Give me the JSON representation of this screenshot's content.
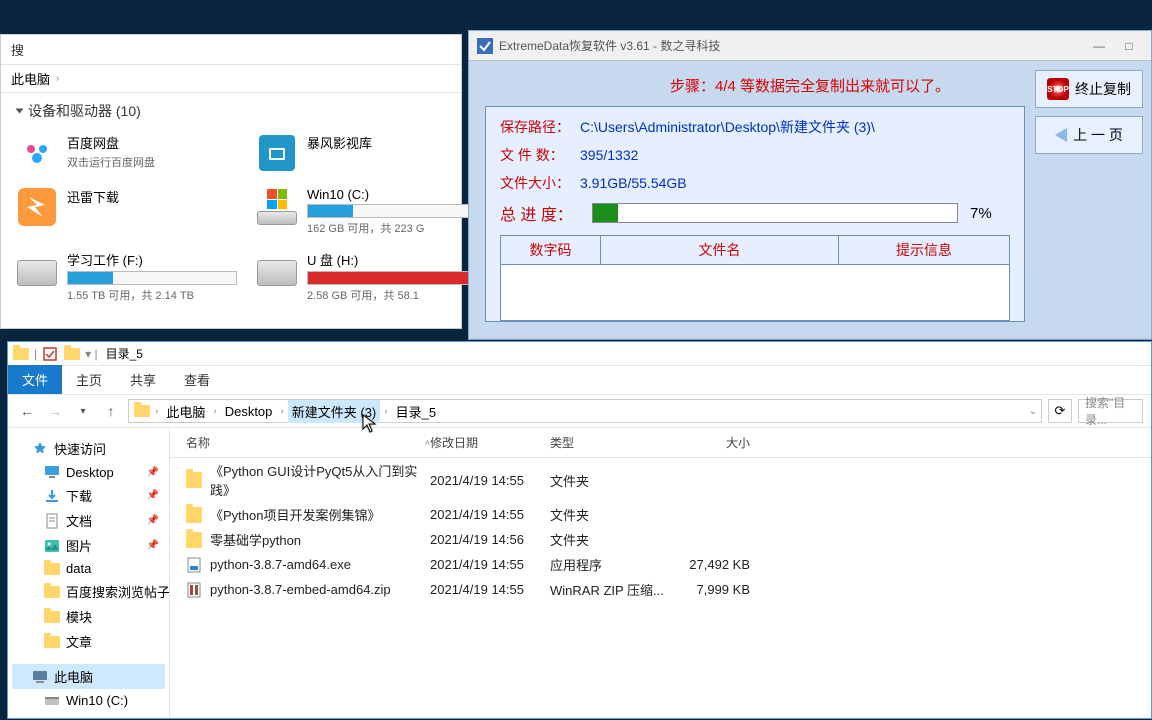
{
  "win1": {
    "ribbon_search": "搜",
    "breadcrumb": "此电脑",
    "section": "设备和驱动器 (10)",
    "drives": [
      {
        "title": "百度网盘",
        "sub": "双击运行百度网盘"
      },
      {
        "title": "暴风影视库",
        "sub": ""
      },
      {
        "title": "迅雷下载",
        "sub": ""
      },
      {
        "title": "Win10 (C:)",
        "sub": "162 GB 可用，共 223 G",
        "bar": 27,
        "color": "blue"
      },
      {
        "title": "学习工作 (F:)",
        "sub": "1.55 TB 可用，共 2.14 TB",
        "bar": 27,
        "color": "blue"
      },
      {
        "title": "U 盘 (H:)",
        "sub": "2.58 GB 可用，共 58.1",
        "bar": 96,
        "color": "red"
      }
    ]
  },
  "win2": {
    "title": "ExtremeData恢复软件 v3.61   - 数之寻科技",
    "msg": "步骤：4/4 等数据完全复制出来就可以了。",
    "rows": {
      "path_label": "保存路径：",
      "path_value": "C:\\Users\\Administrator\\Desktop\\新建文件夹 (3)\\",
      "count_label": "文 件 数：",
      "count_value": "395/1332",
      "size_label": "文件大小：",
      "size_value": "3.91GB/55.54GB",
      "prog_label": "总 进 度："
    },
    "progress_pct": "7%",
    "progress_fill": 7,
    "table": {
      "col1": "数字码",
      "col2": "文件名",
      "col3": "提示信息"
    },
    "btn_stop": "终止复制",
    "btn_prev": "上 一 页",
    "stop_icon_text": "STOP"
  },
  "win3": {
    "title": "目录_5",
    "tabs": [
      "文件",
      "主页",
      "共享",
      "查看"
    ],
    "breadcrumb": [
      "此电脑",
      "Desktop",
      "新建文件夹 (3)",
      "目录_5"
    ],
    "search_placeholder": "搜索\"目录...",
    "columns": {
      "name": "名称",
      "date": "修改日期",
      "type": "类型",
      "size": "大小"
    },
    "tree": {
      "quick": "快速访问",
      "items": [
        {
          "label": "Desktop",
          "pin": true,
          "icon": "desktop"
        },
        {
          "label": "下载",
          "pin": true,
          "icon": "download"
        },
        {
          "label": "文档",
          "pin": true,
          "icon": "doc"
        },
        {
          "label": "图片",
          "pin": true,
          "icon": "pic"
        },
        {
          "label": "data",
          "icon": "folder"
        },
        {
          "label": "百度搜索浏览帖子",
          "icon": "folder"
        },
        {
          "label": "模块",
          "icon": "folder"
        },
        {
          "label": "文章",
          "icon": "folder"
        }
      ],
      "thispc": "此电脑",
      "win10": "Win10 (C:)"
    },
    "files": [
      {
        "name": "《Python GUI设计PyQt5从入门到实践》",
        "date": "2021/4/19 14:55",
        "type": "文件夹",
        "size": "",
        "icon": "folder"
      },
      {
        "name": "《Python项目开发案例集锦》",
        "date": "2021/4/19 14:55",
        "type": "文件夹",
        "size": "",
        "icon": "folder"
      },
      {
        "name": "零基础学python",
        "date": "2021/4/19 14:56",
        "type": "文件夹",
        "size": "",
        "icon": "folder"
      },
      {
        "name": "python-3.8.7-amd64.exe",
        "date": "2021/4/19 14:55",
        "type": "应用程序",
        "size": "27,492 KB",
        "icon": "exe"
      },
      {
        "name": "python-3.8.7-embed-amd64.zip",
        "date": "2021/4/19 14:55",
        "type": "WinRAR ZIP 压缩...",
        "size": "7,999 KB",
        "icon": "zip"
      }
    ]
  }
}
